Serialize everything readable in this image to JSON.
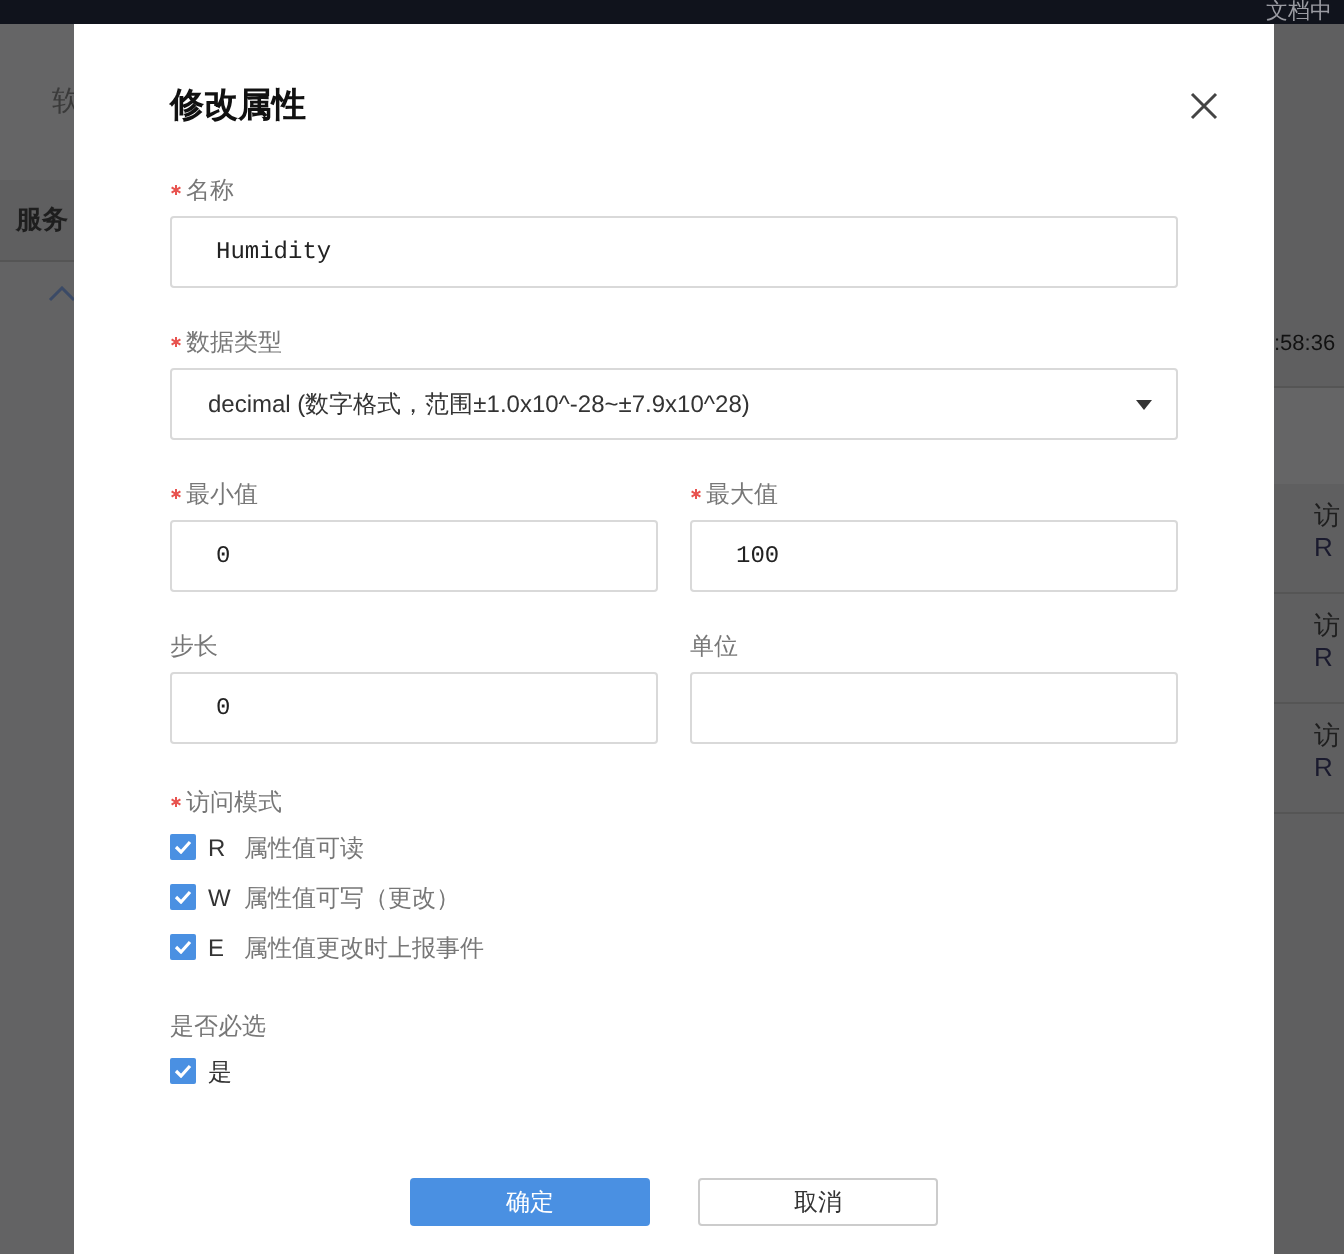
{
  "background": {
    "header_link": "文档中",
    "left_label": "软",
    "section_title": "服务",
    "time": ":58:36",
    "rows": [
      {
        "label": "访",
        "value": "R"
      },
      {
        "label": "访",
        "value": "R"
      },
      {
        "label": "访",
        "value": "R"
      }
    ]
  },
  "dialog": {
    "title": "修改属性",
    "rows": [
      [
        {
          "label": "名称",
          "required": true,
          "kind": "text",
          "value": "Humidity"
        }
      ],
      [
        {
          "label": "数据类型",
          "required": true,
          "kind": "select",
          "value": "decimal (数字格式，范围±1.0x10^-28~±7.9x10^28)"
        }
      ],
      [
        {
          "label": "最小值",
          "required": true,
          "kind": "text",
          "value": "0"
        },
        {
          "label": "最大值",
          "required": true,
          "kind": "text",
          "value": "100"
        }
      ],
      [
        {
          "label": "步长",
          "required": false,
          "kind": "text",
          "value": "0"
        },
        {
          "label": "单位",
          "required": false,
          "kind": "text"
        }
      ]
    ],
    "groups": [
      {
        "label": "访问模式",
        "required": true,
        "options": [
          {
            "code": "R",
            "label": "属性值可读",
            "checked": true
          },
          {
            "code": "W",
            "label": "属性值可写（更改）",
            "checked": true
          },
          {
            "code": "E",
            "label": "属性值更改时上报事件",
            "checked": true
          }
        ]
      },
      {
        "label": "是否必选",
        "required": false,
        "options": [
          {
            "label": "是",
            "checked": true
          }
        ]
      }
    ],
    "buttons": [
      {
        "label": "确定",
        "kind": "primary"
      },
      {
        "label": "取消",
        "kind": "secondary"
      }
    ]
  }
}
